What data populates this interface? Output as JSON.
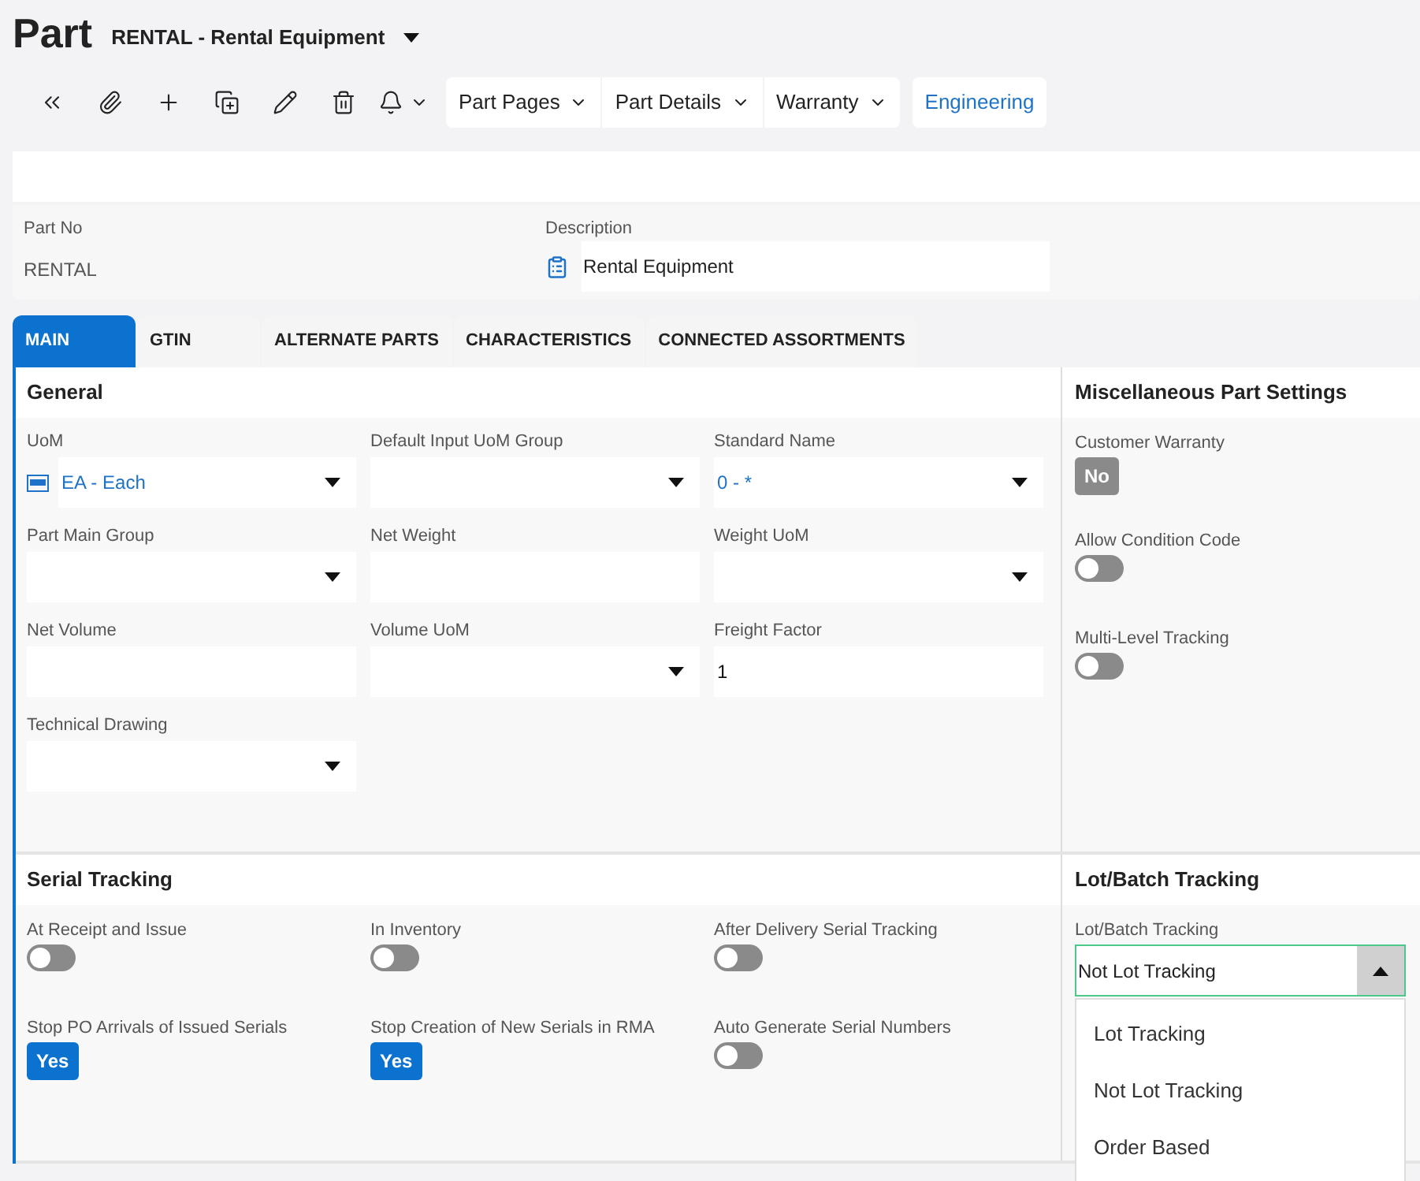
{
  "page": {
    "title": "Part",
    "subtitle": "RENTAL - Rental Equipment"
  },
  "toolbar": {
    "menus": [
      {
        "label": "Part Pages"
      },
      {
        "label": "Part Details"
      },
      {
        "label": "Warranty"
      }
    ],
    "link": "Engineering"
  },
  "header": {
    "fields": [
      {
        "label": "Part No",
        "value": "RENTAL",
        "editable": false
      },
      {
        "label": "Description",
        "value": "Rental Equipment",
        "editable": true
      }
    ]
  },
  "tabs": [
    {
      "label": "MAIN",
      "selected": true
    },
    {
      "label": "GTIN",
      "selected": false
    },
    {
      "label": "ALTERNATE PARTS",
      "selected": false
    },
    {
      "label": "CHARACTERISTICS",
      "selected": false
    },
    {
      "label": "CONNECTED ASSORTMENTS",
      "selected": false
    }
  ],
  "general": {
    "title": "General",
    "fields": [
      {
        "label": "UoM",
        "kind": "select",
        "value": "EA - Each",
        "lookup": true,
        "has_icon": true
      },
      {
        "label": "Default Input UoM Group",
        "kind": "select"
      },
      {
        "label": "Standard Name",
        "kind": "select",
        "value": "0 - *",
        "lookup": true
      },
      {
        "label": "Part Main Group",
        "kind": "select"
      },
      {
        "label": "Net Weight",
        "kind": "input"
      },
      {
        "label": "Weight UoM",
        "kind": "select"
      },
      {
        "label": "Net Volume",
        "kind": "input"
      },
      {
        "label": "Volume UoM",
        "kind": "select"
      },
      {
        "label": "Freight Factor",
        "kind": "input",
        "value": "1",
        "lookup": false
      },
      {
        "label": "Technical Drawing",
        "kind": "select"
      }
    ]
  },
  "misc": {
    "title": "Miscellaneous Part Settings",
    "settings": [
      {
        "label": "Customer Warranty",
        "kind": "badge",
        "value": "No",
        "on": false
      },
      {
        "label": "Allow Condition Code",
        "kind": "toggle",
        "on": false
      },
      {
        "label": "Multi-Level Tracking",
        "kind": "toggle",
        "on": false
      }
    ]
  },
  "serial": {
    "title": "Serial Tracking",
    "settings": [
      {
        "label": "At Receipt and Issue",
        "kind": "toggle",
        "on": false
      },
      {
        "label": "In Inventory",
        "kind": "toggle",
        "on": false
      },
      {
        "label": "After Delivery Serial Tracking",
        "kind": "toggle",
        "on": false
      },
      {
        "label": "Stop PO Arrivals of Issued Serials",
        "kind": "badge",
        "value": "Yes",
        "on": true
      },
      {
        "label": "Stop Creation of New Serials in RMA",
        "kind": "badge",
        "value": "Yes",
        "on": true
      },
      {
        "label": "Auto Generate Serial Numbers",
        "kind": "toggle",
        "on": false
      }
    ]
  },
  "lot": {
    "title": "Lot/Batch Tracking",
    "label": "Lot/Batch Tracking",
    "value": "Not Lot Tracking",
    "expanded": true,
    "options": [
      {
        "label": "Lot Tracking"
      },
      {
        "label": "Not Lot Tracking"
      },
      {
        "label": "Order Based"
      }
    ]
  }
}
